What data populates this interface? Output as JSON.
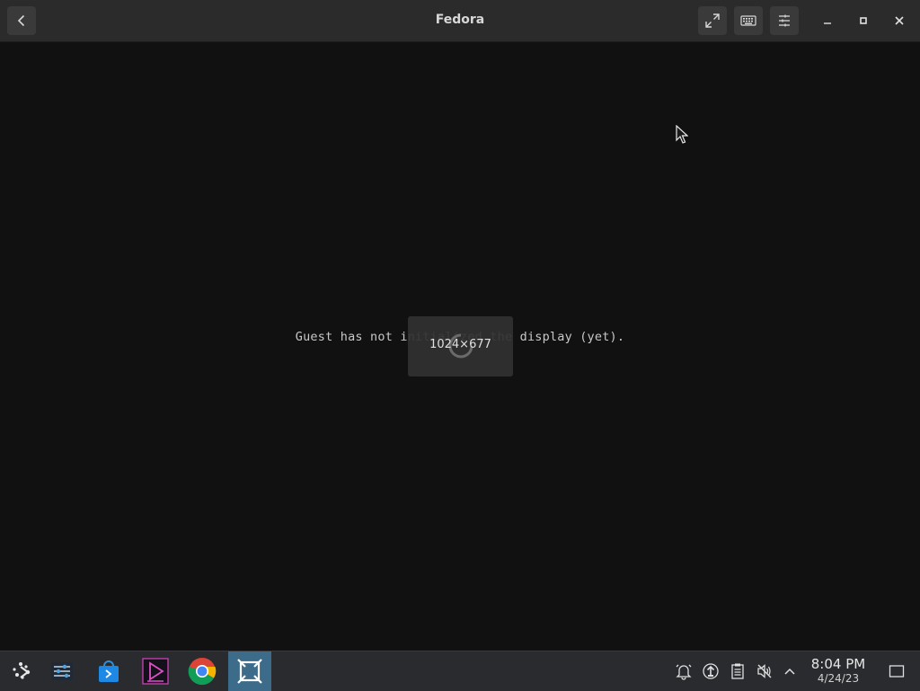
{
  "window": {
    "title": "Fedora",
    "buttons": {
      "back": "back-arrow-icon",
      "fullscreen": "expand-icon",
      "keyboard": "keyboard-icon",
      "preferences": "sliders-icon",
      "minimize": "minimize-icon",
      "maximize": "maximize-icon",
      "close": "close-icon"
    }
  },
  "viewport": {
    "message": "Guest has not initialized the display (yet).",
    "osd_resolution": "1024×677"
  },
  "taskbar": {
    "launchers": [
      {
        "name": "application-launcher",
        "icon": "steamos-logo-icon"
      },
      {
        "name": "system-settings",
        "icon": "sliders-icon"
      },
      {
        "name": "discover-store",
        "icon": "store-bag-icon"
      },
      {
        "name": "media-player",
        "icon": "play-triangle-icon"
      },
      {
        "name": "google-chrome",
        "icon": "chrome-icon"
      },
      {
        "name": "boxes",
        "icon": "boxes-icon",
        "active": true
      }
    ],
    "tray": [
      "notifications-icon",
      "update-icon",
      "clipboard-icon",
      "volume-muted-icon",
      "chevron-up-icon"
    ],
    "clock": {
      "time": "8:04 PM",
      "date": "4/24/23"
    },
    "show_desktop": "show-desktop-icon"
  },
  "colors": {
    "titlebar": "#2b2b2b",
    "viewport": "#111112",
    "taskbar": "#2a2b2e",
    "active_task": "#3d6c8a"
  }
}
